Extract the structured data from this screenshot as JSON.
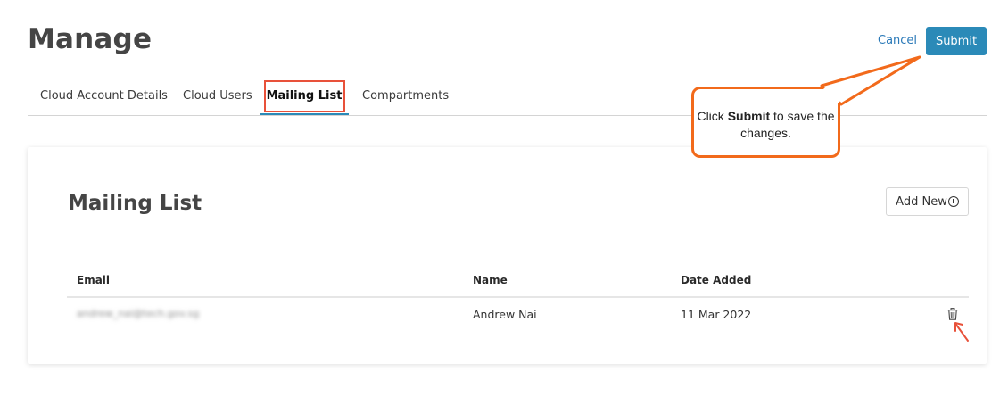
{
  "header": {
    "title": "Manage",
    "cancel_label": "Cancel",
    "submit_label": "Submit"
  },
  "tabs": [
    {
      "label": "Cloud Account Details",
      "active": false
    },
    {
      "label": "Cloud Users",
      "active": false
    },
    {
      "label": "Mailing List",
      "active": true
    },
    {
      "label": "Compartments",
      "active": false
    }
  ],
  "callout": {
    "prefix": "Click ",
    "emphasis": "Submit",
    "suffix": " to save the changes."
  },
  "card": {
    "title": "Mailing List",
    "add_new_label": "Add New"
  },
  "table": {
    "columns": [
      "Email",
      "Name",
      "Date Added"
    ],
    "rows": [
      {
        "email": "andrew_nai@tech.gov.sg",
        "name": "Andrew Nai",
        "date_added": "11 Mar 2022"
      }
    ]
  },
  "icons": {
    "add": "plus-circle-icon",
    "delete": "trash-icon"
  },
  "colors": {
    "accent": "#2b8ab8",
    "annotation": "#f26a1b",
    "highlight": "#e8513a"
  }
}
